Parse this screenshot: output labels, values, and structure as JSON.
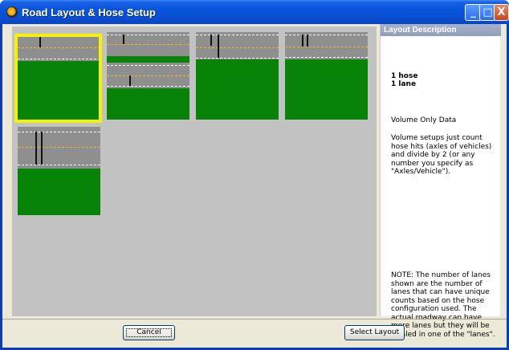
{
  "window": {
    "title": "Road Layout & Hose Setup"
  },
  "title_buttons": {
    "minimize": "_",
    "maximize": "□",
    "close": "X"
  },
  "layouts": [
    {
      "id": "layout-1",
      "hoses": 1,
      "lanes": 1,
      "selected": true
    },
    {
      "id": "layout-2",
      "hoses": 1,
      "lanes": 2,
      "selected": false
    },
    {
      "id": "layout-3",
      "hoses": 2,
      "lanes": 1,
      "selected": false
    },
    {
      "id": "layout-4",
      "hoses": 2,
      "lanes": 1,
      "selected": false
    },
    {
      "id": "layout-5",
      "hoses": 2,
      "lanes": 1,
      "selected": false
    }
  ],
  "description": {
    "header": "Layout Description",
    "hoses": "1 hose",
    "lanes": "1 lane",
    "data_type": "Volume Only Data",
    "body": "Volume setups just count hose hits (axles of vehicles) and divide by 2 (or any number you specify as \"Axles/Vehicle\").",
    "note": "NOTE: The number of lanes shown are the number of lanes that can have unique counts based on the hose configuration used.  The actual roadway can have more lanes but they will be totaled in one of the \"lanes\"."
  },
  "buttons": {
    "cancel": "Cancel",
    "select_layout": "Select Layout"
  },
  "colors": {
    "grass": "#078307",
    "road": "#8f8f8f",
    "selection": "#f5f200",
    "title_bar": "#0a4fd4"
  }
}
